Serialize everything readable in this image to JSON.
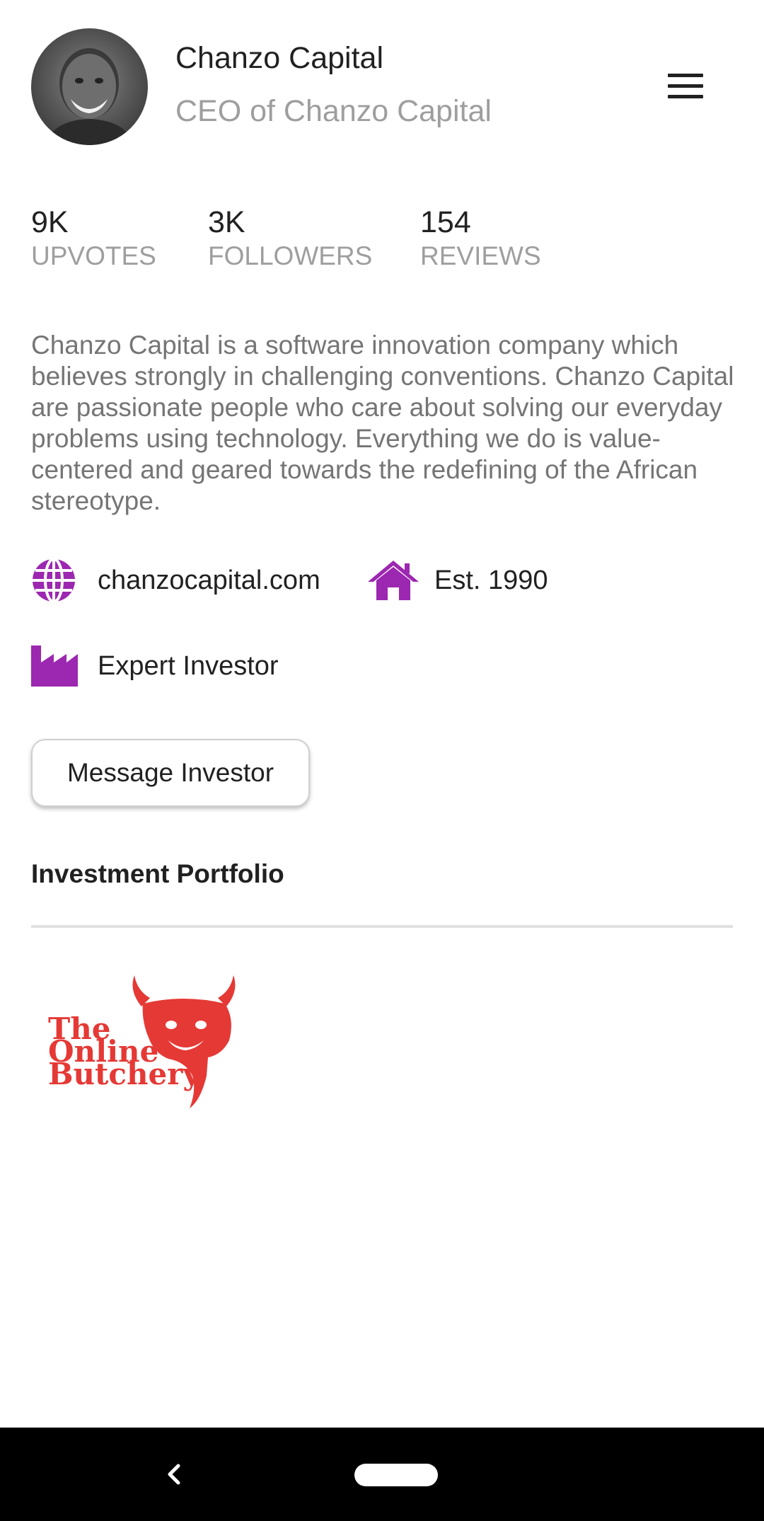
{
  "profile": {
    "name": "Chanzo Capital",
    "role": "CEO of Chanzo Capital"
  },
  "stats": [
    {
      "value": "9K",
      "label": "UPVOTES"
    },
    {
      "value": "3K",
      "label": "FOLLOWERS"
    },
    {
      "value": "154",
      "label": "REVIEWS"
    }
  ],
  "about": "Chanzo Capital is a software innovation company which believes strongly in challenging conventions. Chanzo Capital are passionate people who care about solving our everyday problems using technology. Everything we do is value-centered and geared towards the redefining of the African stereotype.",
  "info": {
    "website": "chanzocapital.com",
    "established": "Est. 1990",
    "category": "Expert Investor"
  },
  "actions": {
    "message_label": "Message Investor"
  },
  "portfolio": {
    "title": "Investment Portfolio",
    "items": [
      {
        "logo_line1": "The",
        "logo_line2": "Online",
        "logo_line3": "Butchery"
      }
    ]
  },
  "colors": {
    "accent": "#9c27b0",
    "logo_red": "#e53935",
    "primary_text": "#212121",
    "secondary_text": "#9e9e9e"
  },
  "icons": {
    "menu": "hamburger-menu-icon",
    "website": "globe-icon",
    "established": "home-icon",
    "category": "factory-icon",
    "back": "back-chevron-icon"
  }
}
